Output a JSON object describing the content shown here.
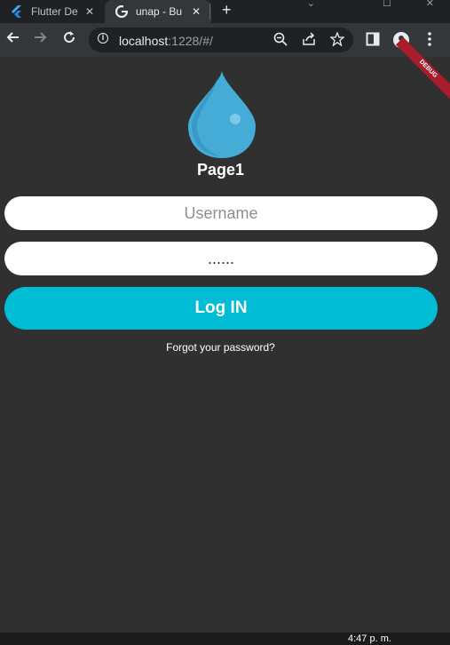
{
  "tabs": [
    {
      "title": "Flutter De",
      "close": "✕",
      "icon": "flutter-icon"
    },
    {
      "title": "unap - Bu",
      "close": "✕",
      "icon": "google-icon"
    }
  ],
  "new_tab": "+",
  "toolbar": {
    "url_host": "localhost",
    "url_rest": ":1228/#/"
  },
  "app": {
    "debug_label": "DEBUG",
    "title": "Page1",
    "username_placeholder": "Username",
    "password_value": "......",
    "login_label": "Log IN",
    "forgot_label": "Forgot your password?",
    "colors": {
      "background": "#303030",
      "accent": "#00bcd4",
      "drop": "#45acd8"
    }
  },
  "taskbar": {
    "time": "4:47 p. m."
  }
}
